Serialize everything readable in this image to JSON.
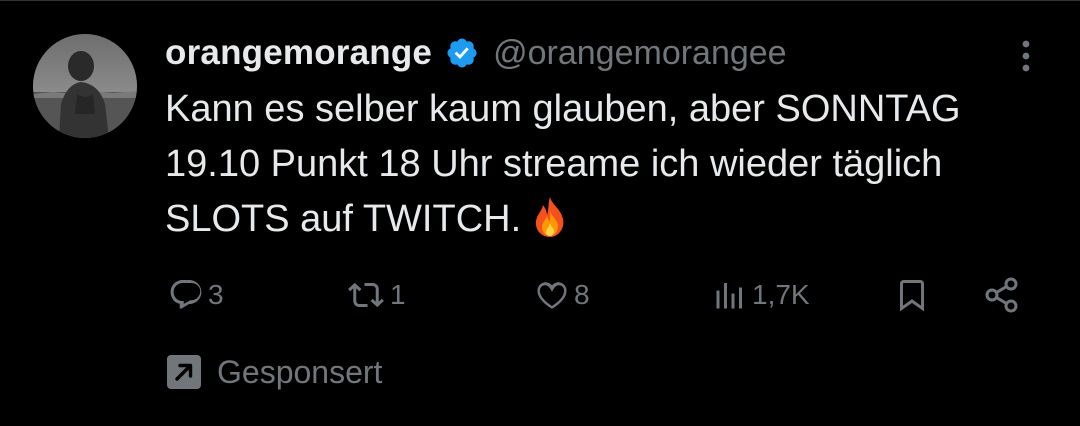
{
  "author": {
    "display_name": "orangemorange",
    "handle": "@orangemorangee",
    "verified": true
  },
  "tweet": {
    "lines": [
      "Kann es selber kaum glauben, aber SONNTAG",
      "19.10 Punkt 18 Uhr streame ich wieder täglich",
      "SLOTS auf TWITCH."
    ],
    "emoji": "fire-icon"
  },
  "actions": {
    "replies": "3",
    "retweets": "1",
    "likes": "8",
    "views": "1,7K"
  },
  "promo": {
    "label": "Gesponsert"
  },
  "colors": {
    "background": "#000000",
    "text_primary": "#e7e9ea",
    "text_secondary": "#71767b",
    "verified_badge": "#1d9bf0"
  }
}
